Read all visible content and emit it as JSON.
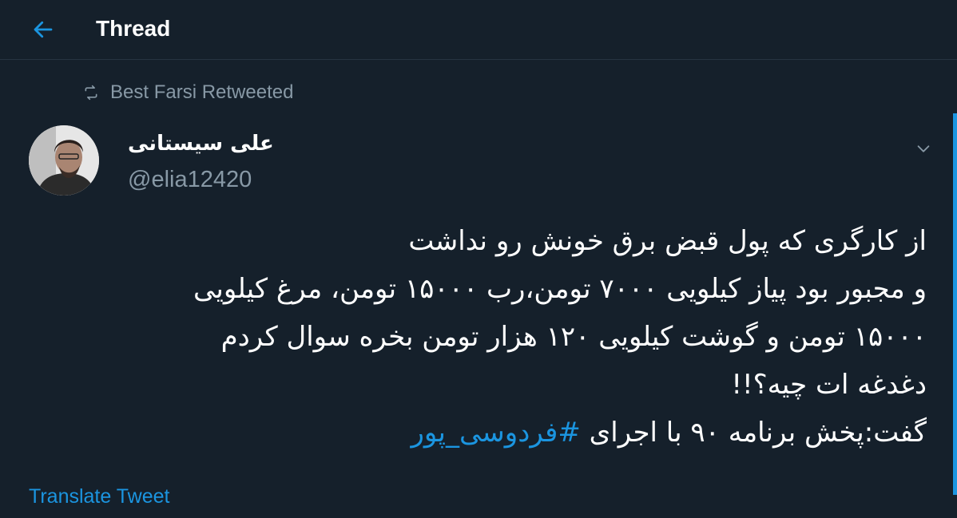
{
  "header": {
    "title": "Thread",
    "back_icon": "back-arrow-icon"
  },
  "retweet_context": {
    "text": "Best Farsi Retweeted",
    "icon": "retweet-icon"
  },
  "tweet": {
    "author": {
      "display_name": "علی سیستانی",
      "handle": "@elia12420"
    },
    "menu_icon": "chevron-down-icon",
    "lines": [
      "از کارگری که پول قبض برق خونش رو نداشت",
      "و مجبور بود پیاز کیلویی ۷۰۰۰ تومن،رب ۱۵۰۰۰ تومن، مرغ کیلویی",
      "۱۵۰۰۰ تومن و گوشت کیلویی ۱۲۰ هزار تومن بخره سوال کردم",
      "دغدغه ات چیه؟!!"
    ],
    "last_line_text": "گفت:پخش برنامه ۹۰ با اجرای ",
    "hashtag": "#فردوسی_پور",
    "translate_label": "Translate Tweet"
  },
  "colors": {
    "background": "#15202b",
    "accent": "#1b95e0",
    "muted_text": "#8899a6"
  }
}
